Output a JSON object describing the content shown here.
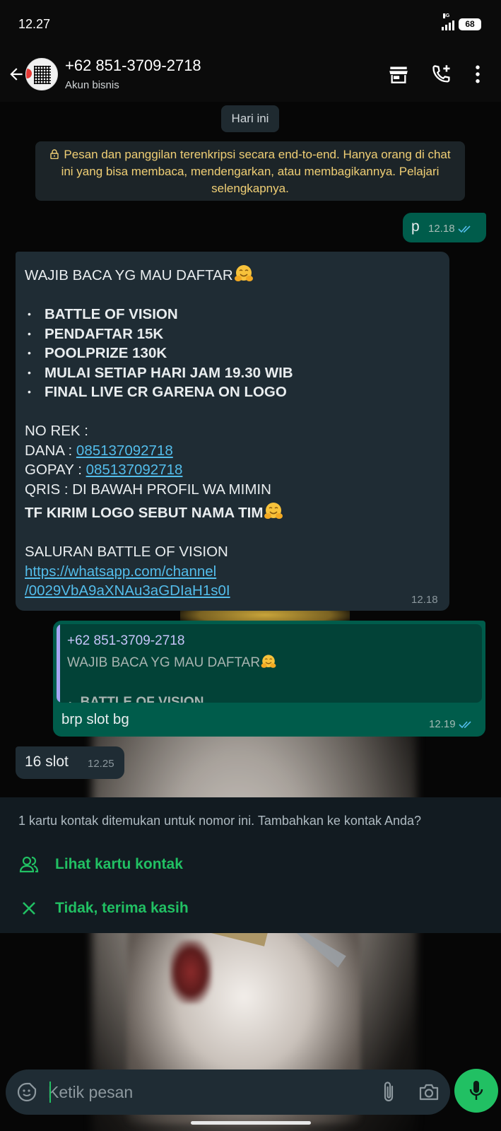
{
  "status_bar": {
    "time": "12.27",
    "network": "4G",
    "battery": "68"
  },
  "header": {
    "contact_name": "+62 851-3709-2718",
    "contact_subtitle": "Akun bisnis",
    "icons": [
      "back-arrow-icon",
      "storefront-icon",
      "add-call-icon",
      "more-vertical-icon"
    ]
  },
  "chat": {
    "date_chip": "Hari ini",
    "encryption_notice": "Pesan dan panggilan terenkripsi secara end-to-end. Hanya orang di chat ini yang bisa membaca, mendengarkan, atau membagikannya. Pelajari selengkapnya.",
    "messages": [
      {
        "direction": "outgoing",
        "text": "p",
        "time": "12.18",
        "status": "read"
      },
      {
        "direction": "incoming",
        "time": "12.18",
        "heading": "WAJIB BACA YG MAU DAFTAR",
        "bullets": [
          "BATTLE OF VISION",
          "PENDAFTAR 15K",
          "POOLPRIZE 130K",
          "MULAI SETIAP HARI JAM 19.30 WIB",
          "FINAL LIVE CR GARENA ON LOGO"
        ],
        "rek_label": "NO REK :",
        "dana_label": "DANA : ",
        "dana_number": "085137092718",
        "gopay_label": "GOPAY : ",
        "gopay_number": "085137092718",
        "qris_line": "QRIS : DI BAWAH PROFIL WA MIMIN",
        "tf_line": "TF KIRIM LOGO SEBUT NAMA TIM",
        "channel_label": "SALURAN BATTLE OF VISION",
        "channel_link_1": "https://whatsapp.com/channel",
        "channel_link_2": "/0029VbA9aXNAu3aGDIaH1s0I"
      },
      {
        "direction": "outgoing",
        "time": "12.19",
        "status": "read",
        "quote_name": "+62 851-3709-2718",
        "quote_line_1": "WAJIB BACA YG MAU DAFTAR",
        "quote_line_2": "BATTLE OF VISION...",
        "text": "brp slot bg"
      },
      {
        "direction": "incoming",
        "text": "16 slot",
        "time": "12.25"
      }
    ]
  },
  "contact_prompt": {
    "text": "1 kartu kontak ditemukan untuk nomor ini. Tambahkan ke kontak Anda?",
    "view_label": "Lihat kartu kontak",
    "dismiss_label": "Tidak, terima kasih"
  },
  "composer": {
    "placeholder": "Ketik pesan"
  },
  "colors": {
    "accent": "#21c063",
    "outgoing_bubble": "#005c4b",
    "incoming_bubble": "#1f2c34",
    "link": "#53bdeb",
    "notice_text": "#f0cf75"
  }
}
